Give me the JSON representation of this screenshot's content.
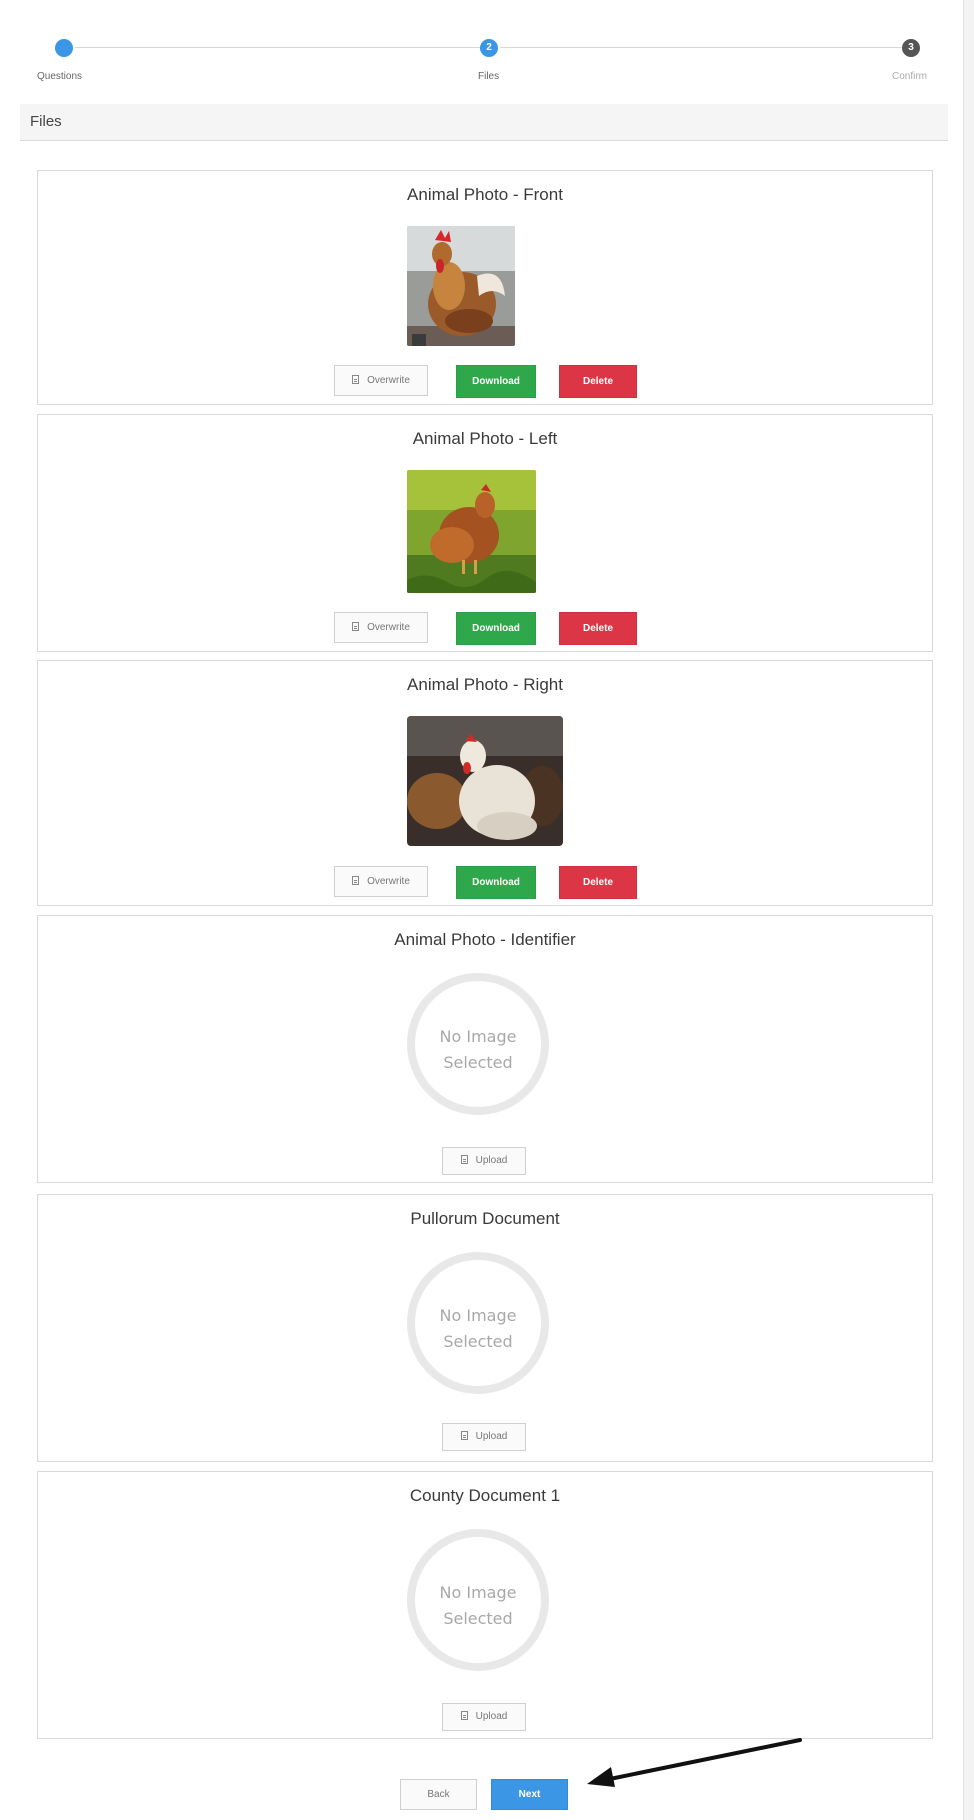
{
  "stepper": {
    "steps": [
      {
        "label": "Questions",
        "number": "",
        "color": "#3b96e6",
        "state": "complete"
      },
      {
        "label": "Files",
        "number": "2",
        "color": "#3b96e6",
        "state": "active"
      },
      {
        "label": "Confirm",
        "number": "3",
        "color": "#555555",
        "state": "upcoming"
      }
    ]
  },
  "section": {
    "title": "Files"
  },
  "cards": [
    {
      "title": "Animal Photo - Front",
      "image": "rooster-photo",
      "buttons": {
        "overwrite": "Overwrite",
        "download": "Download",
        "delete": "Delete"
      }
    },
    {
      "title": "Animal Photo - Left",
      "image": "hen-in-grass-photo",
      "buttons": {
        "overwrite": "Overwrite",
        "download": "Download",
        "delete": "Delete"
      }
    },
    {
      "title": "Animal Photo - Right",
      "image": "white-hen-photo",
      "buttons": {
        "overwrite": "Overwrite",
        "download": "Download",
        "delete": "Delete"
      }
    },
    {
      "title": "Animal Photo - Identifier",
      "placeholder": {
        "line1": "No Image",
        "line2": "Selected"
      },
      "buttons": {
        "upload": "Upload"
      }
    },
    {
      "title": "Pullorum Document",
      "placeholder": {
        "line1": "No Image",
        "line2": "Selected"
      },
      "buttons": {
        "upload": "Upload"
      }
    },
    {
      "title": "County Document 1",
      "placeholder": {
        "line1": "No Image",
        "line2": "Selected"
      },
      "buttons": {
        "upload": "Upload"
      }
    }
  ],
  "nav": {
    "back": "Back",
    "next": "Next"
  },
  "colors": {
    "accent": "#3b96e6",
    "download": "#2ea84a",
    "delete": "#dc3545"
  }
}
